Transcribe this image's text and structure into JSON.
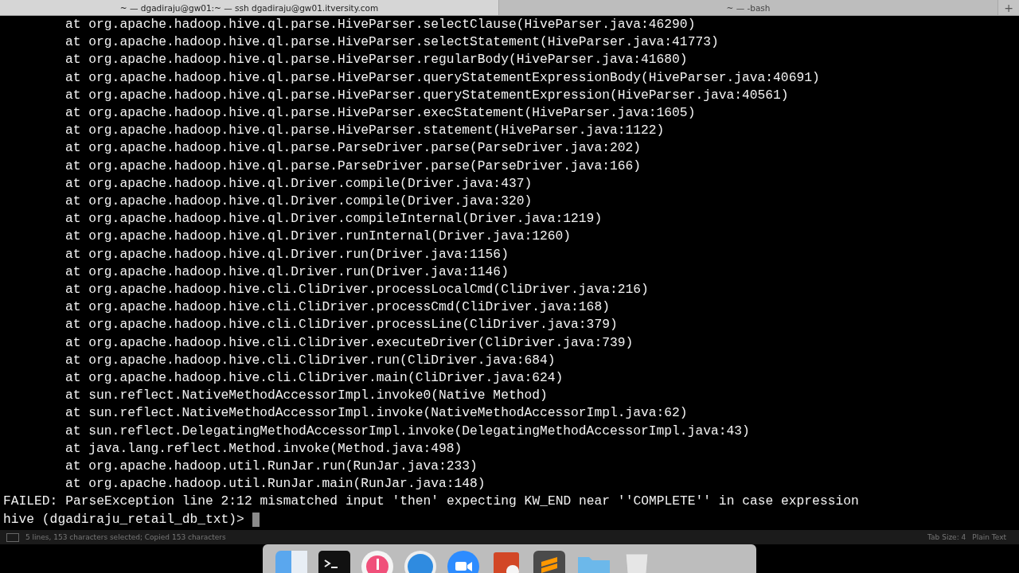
{
  "tabs": [
    {
      "title": "~ — dgadiraju@gw01:~ — ssh dgadiraju@gw01.itversity.com",
      "selected": true
    },
    {
      "title": "~ — -bash",
      "selected": false
    }
  ],
  "new_tab": "+",
  "lines": [
    {
      "kind": "frame",
      "text": "at org.apache.hadoop.hive.ql.parse.HiveParser.selectClause(HiveParser.java:46290)"
    },
    {
      "kind": "frame",
      "text": "at org.apache.hadoop.hive.ql.parse.HiveParser.selectStatement(HiveParser.java:41773)"
    },
    {
      "kind": "frame",
      "text": "at org.apache.hadoop.hive.ql.parse.HiveParser.regularBody(HiveParser.java:41680)"
    },
    {
      "kind": "frame",
      "text": "at org.apache.hadoop.hive.ql.parse.HiveParser.queryStatementExpressionBody(HiveParser.java:40691)"
    },
    {
      "kind": "frame",
      "text": "at org.apache.hadoop.hive.ql.parse.HiveParser.queryStatementExpression(HiveParser.java:40561)"
    },
    {
      "kind": "frame",
      "text": "at org.apache.hadoop.hive.ql.parse.HiveParser.execStatement(HiveParser.java:1605)"
    },
    {
      "kind": "frame",
      "text": "at org.apache.hadoop.hive.ql.parse.HiveParser.statement(HiveParser.java:1122)"
    },
    {
      "kind": "frame",
      "text": "at org.apache.hadoop.hive.ql.parse.ParseDriver.parse(ParseDriver.java:202)"
    },
    {
      "kind": "frame",
      "text": "at org.apache.hadoop.hive.ql.parse.ParseDriver.parse(ParseDriver.java:166)"
    },
    {
      "kind": "frame",
      "text": "at org.apache.hadoop.hive.ql.Driver.compile(Driver.java:437)"
    },
    {
      "kind": "frame",
      "text": "at org.apache.hadoop.hive.ql.Driver.compile(Driver.java:320)"
    },
    {
      "kind": "frame",
      "text": "at org.apache.hadoop.hive.ql.Driver.compileInternal(Driver.java:1219)"
    },
    {
      "kind": "frame",
      "text": "at org.apache.hadoop.hive.ql.Driver.runInternal(Driver.java:1260)"
    },
    {
      "kind": "frame",
      "text": "at org.apache.hadoop.hive.ql.Driver.run(Driver.java:1156)"
    },
    {
      "kind": "frame",
      "text": "at org.apache.hadoop.hive.ql.Driver.run(Driver.java:1146)"
    },
    {
      "kind": "frame",
      "text": "at org.apache.hadoop.hive.cli.CliDriver.processLocalCmd(CliDriver.java:216)"
    },
    {
      "kind": "frame",
      "text": "at org.apache.hadoop.hive.cli.CliDriver.processCmd(CliDriver.java:168)"
    },
    {
      "kind": "frame",
      "text": "at org.apache.hadoop.hive.cli.CliDriver.processLine(CliDriver.java:379)"
    },
    {
      "kind": "frame",
      "text": "at org.apache.hadoop.hive.cli.CliDriver.executeDriver(CliDriver.java:739)"
    },
    {
      "kind": "frame",
      "text": "at org.apache.hadoop.hive.cli.CliDriver.run(CliDriver.java:684)"
    },
    {
      "kind": "frame",
      "text": "at org.apache.hadoop.hive.cli.CliDriver.main(CliDriver.java:624)"
    },
    {
      "kind": "frame",
      "text": "at sun.reflect.NativeMethodAccessorImpl.invoke0(Native Method)"
    },
    {
      "kind": "frame",
      "text": "at sun.reflect.NativeMethodAccessorImpl.invoke(NativeMethodAccessorImpl.java:62)"
    },
    {
      "kind": "frame",
      "text": "at sun.reflect.DelegatingMethodAccessorImpl.invoke(DelegatingMethodAccessorImpl.java:43)"
    },
    {
      "kind": "frame",
      "text": "at java.lang.reflect.Method.invoke(Method.java:498)"
    },
    {
      "kind": "frame",
      "text": "at org.apache.hadoop.util.RunJar.run(RunJar.java:233)"
    },
    {
      "kind": "frame",
      "text": "at org.apache.hadoop.util.RunJar.main(RunJar.java:148)"
    },
    {
      "kind": "error",
      "text": "FAILED: ParseException line 2:12 mismatched input 'then' expecting KW_END near ''COMPLETE'' in case expression"
    }
  ],
  "prompt": "hive (dgadiraju_retail_db_txt)>",
  "status_bar": {
    "message": "5 lines, 153 characters selected; Copied 153 characters",
    "tab_size": "Tab Size: 4",
    "syntax": "Plain Text"
  }
}
